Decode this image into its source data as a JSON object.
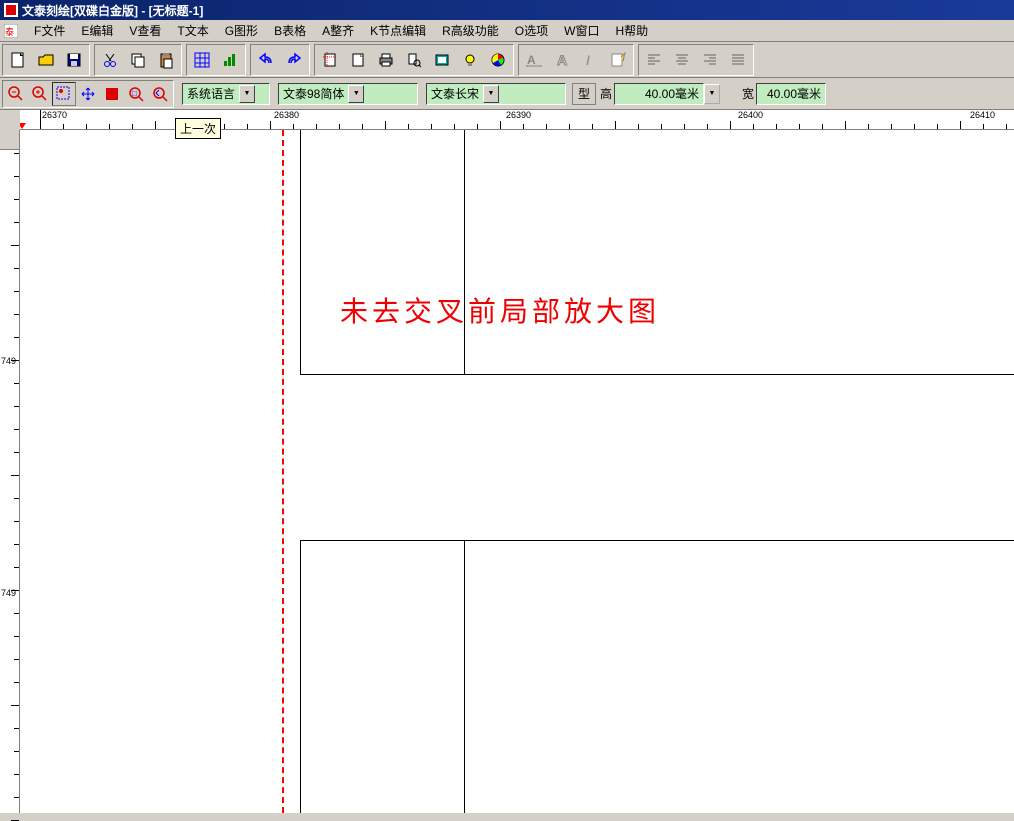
{
  "title": "文泰刻绘[双碟白金版] - [无标题-1]",
  "menu": {
    "file": "F文件",
    "edit": "E编辑",
    "view": "V查看",
    "text": "T文本",
    "graphic": "G图形",
    "table": "B表格",
    "arrange": "A整齐",
    "node": "K节点编辑",
    "advanced": "R高级功能",
    "options": "O选项",
    "window": "W窗口",
    "help": "H帮助"
  },
  "dropdowns": {
    "language": "系统语言",
    "font1": "文泰98简体",
    "font2": "文泰长宋",
    "type_btn": "型"
  },
  "dimensions": {
    "height_label": "高",
    "height_value": "40.00毫米",
    "width_label": "宽",
    "width_value": "40.00毫米"
  },
  "ruler": {
    "h_values": [
      "26370",
      "26380",
      "26390",
      "26400",
      "26410"
    ],
    "v_values": [
      "749",
      "749"
    ]
  },
  "tooltip": "上一次",
  "canvas_text": "未去交叉前局部放大图"
}
